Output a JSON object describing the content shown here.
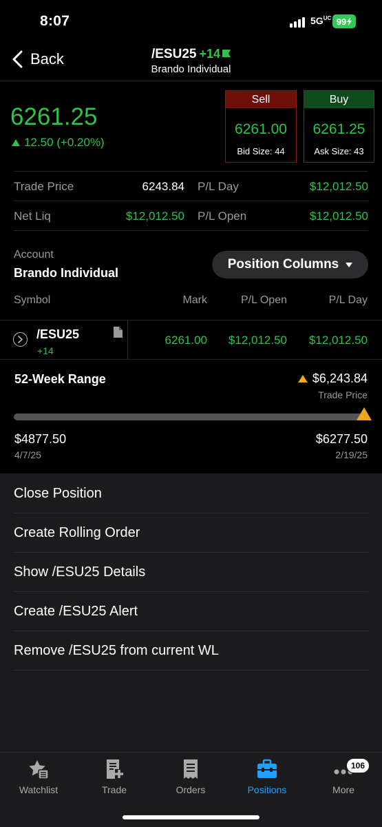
{
  "status": {
    "time": "8:07",
    "network": "5G",
    "network_sub": "UC",
    "battery": "99"
  },
  "nav": {
    "back_label": "Back",
    "symbol": "/ESU25",
    "change": "+14",
    "account": "Brando Individual"
  },
  "quote": {
    "last": "6261.25",
    "change": "12.50 (+0.20%)",
    "sell_label": "Sell",
    "sell_price": "6261.00",
    "bid_size": "Bid Size: 44",
    "buy_label": "Buy",
    "buy_price": "6261.25",
    "ask_size": "Ask Size: 43"
  },
  "stats": {
    "trade_price_label": "Trade Price",
    "trade_price": "6243.84",
    "pl_day_label": "P/L Day",
    "pl_day": "$12,012.50",
    "net_liq_label": "Net Liq",
    "net_liq": "$12,012.50",
    "pl_open_label": "P/L Open",
    "pl_open": "$12,012.50"
  },
  "account": {
    "label": "Account",
    "name": "Brando Individual",
    "columns_button": "Position Columns"
  },
  "table": {
    "headers": [
      "Symbol",
      "Mark",
      "P/L Open",
      "P/L Day"
    ],
    "row": {
      "symbol": "/ESU25",
      "qty": "+14",
      "mark": "6261.00",
      "pl_open": "$12,012.50",
      "pl_day": "$12,012.50"
    }
  },
  "range": {
    "title": "52-Week Range",
    "trade_price": "$6,243.84",
    "trade_price_label": "Trade Price",
    "low": "$4877.50",
    "low_date": "4/7/25",
    "high": "$6277.50",
    "high_date": "2/19/25",
    "position_fraction": 0.99
  },
  "actions": [
    "Close Position",
    "Create Rolling Order",
    "Show /ESU25 Details",
    "Create /ESU25 Alert",
    "Remove /ESU25 from current WL"
  ],
  "tabs": [
    {
      "label": "Watchlist",
      "icon": "watchlist-star-icon"
    },
    {
      "label": "Trade",
      "icon": "trade-icon"
    },
    {
      "label": "Orders",
      "icon": "orders-receipt-icon"
    },
    {
      "label": "Positions",
      "icon": "positions-briefcase-icon"
    },
    {
      "label": "More",
      "icon": "more-dots-icon",
      "badge": "106"
    }
  ],
  "colors": {
    "green": "#2fc349",
    "sell": "#6e0f0b",
    "buy": "#0f4a1d",
    "accent": "#1fa2ff",
    "warning": "#f0a61c"
  }
}
